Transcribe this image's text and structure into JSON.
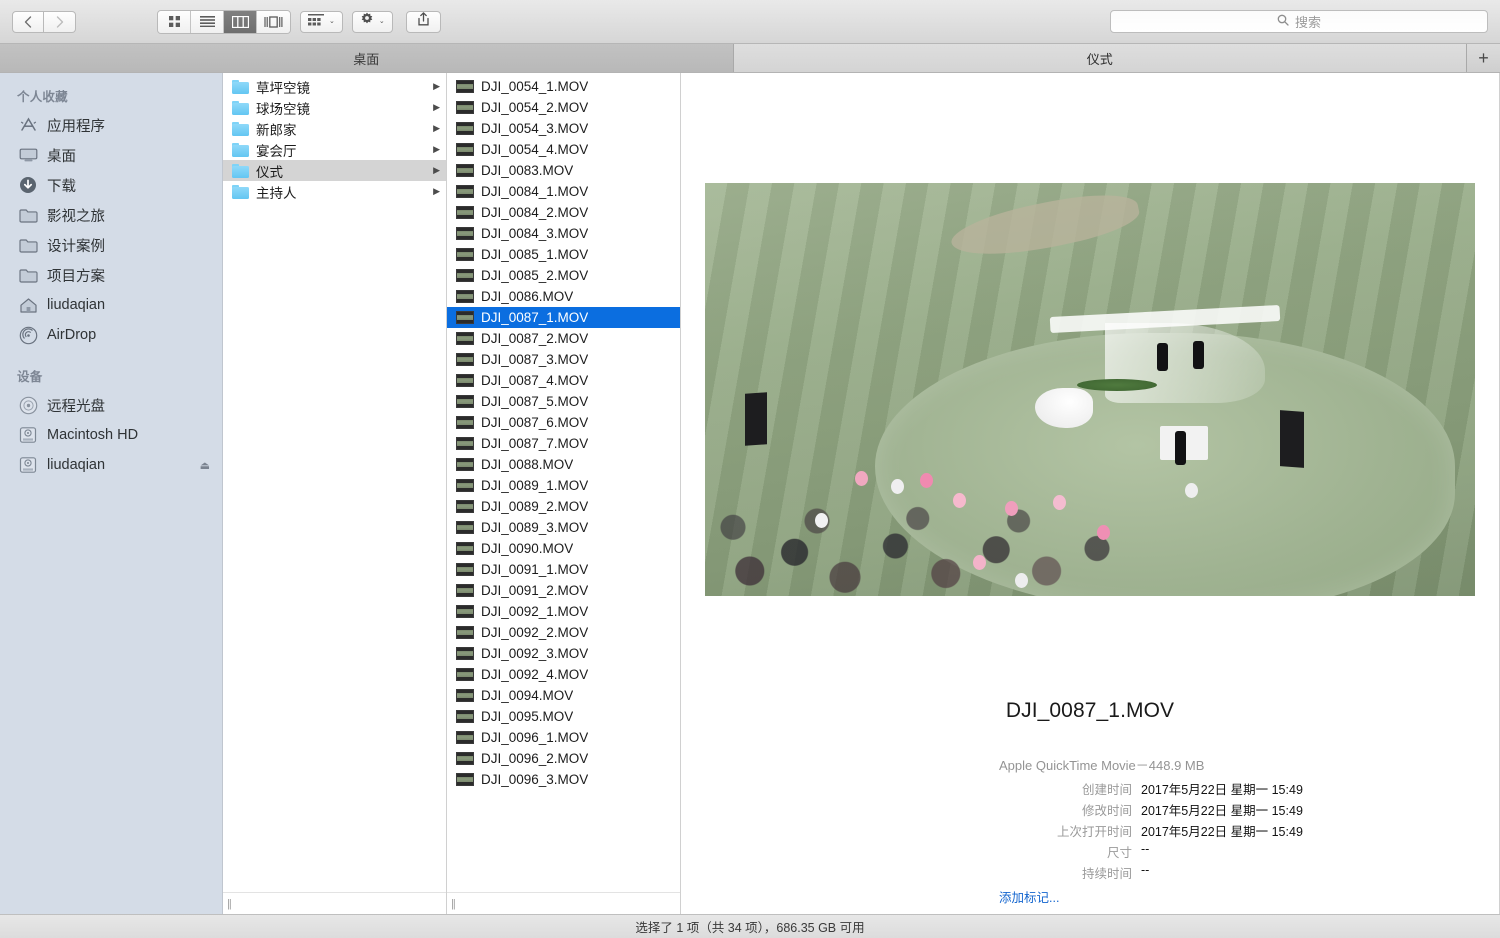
{
  "toolbar": {
    "back_label": "‹",
    "forward_label": "›",
    "view_icon_grid": "icon-view-icon",
    "view_list": "list-view-icon",
    "view_column": "column-view-icon",
    "view_gallery": "gallery-view-icon",
    "arrange_label": "arrange-icon",
    "action_label": "gear-icon",
    "share_label": "share-icon",
    "chevron": "⌄"
  },
  "search": {
    "placeholder": "搜索",
    "icon": "search-icon"
  },
  "tabs": [
    {
      "label": "桌面",
      "active": false
    },
    {
      "label": "仪式",
      "active": true
    }
  ],
  "tab_add_label": "+",
  "sidebar": {
    "sections": [
      {
        "header": "个人收藏",
        "items": [
          {
            "label": "应用程序",
            "icon": "applications-icon"
          },
          {
            "label": "桌面",
            "icon": "desktop-icon"
          },
          {
            "label": "下载",
            "icon": "downloads-icon"
          },
          {
            "label": "影视之旅",
            "icon": "folder-icon"
          },
          {
            "label": "设计案例",
            "icon": "folder-icon"
          },
          {
            "label": "项目方案",
            "icon": "folder-icon"
          },
          {
            "label": "liudaqian",
            "icon": "home-icon"
          },
          {
            "label": "AirDrop",
            "icon": "airdrop-icon"
          }
        ]
      },
      {
        "header": "设备",
        "items": [
          {
            "label": "远程光盘",
            "icon": "disc-icon"
          },
          {
            "label": "Macintosh HD",
            "icon": "harddisk-icon"
          },
          {
            "label": "liudaqian",
            "icon": "harddisk-icon",
            "eject": "⏏"
          }
        ]
      }
    ]
  },
  "columns": {
    "folders": [
      {
        "label": "草坪空镜",
        "selected": false
      },
      {
        "label": "球场空镜",
        "selected": false
      },
      {
        "label": "新郎家",
        "selected": false
      },
      {
        "label": "宴会厅",
        "selected": false
      },
      {
        "label": "仪式",
        "selected": true
      },
      {
        "label": "主持人",
        "selected": false
      }
    ],
    "files": [
      {
        "label": "DJI_0054_1.MOV",
        "selected": false
      },
      {
        "label": "DJI_0054_2.MOV",
        "selected": false
      },
      {
        "label": "DJI_0054_3.MOV",
        "selected": false
      },
      {
        "label": "DJI_0054_4.MOV",
        "selected": false
      },
      {
        "label": "DJI_0083.MOV",
        "selected": false
      },
      {
        "label": "DJI_0084_1.MOV",
        "selected": false
      },
      {
        "label": "DJI_0084_2.MOV",
        "selected": false
      },
      {
        "label": "DJI_0084_3.MOV",
        "selected": false
      },
      {
        "label": "DJI_0085_1.MOV",
        "selected": false
      },
      {
        "label": "DJI_0085_2.MOV",
        "selected": false
      },
      {
        "label": "DJI_0086.MOV",
        "selected": false
      },
      {
        "label": "DJI_0087_1.MOV",
        "selected": true
      },
      {
        "label": "DJI_0087_2.MOV",
        "selected": false
      },
      {
        "label": "DJI_0087_3.MOV",
        "selected": false
      },
      {
        "label": "DJI_0087_4.MOV",
        "selected": false
      },
      {
        "label": "DJI_0087_5.MOV",
        "selected": false
      },
      {
        "label": "DJI_0087_6.MOV",
        "selected": false
      },
      {
        "label": "DJI_0087_7.MOV",
        "selected": false
      },
      {
        "label": "DJI_0088.MOV",
        "selected": false
      },
      {
        "label": "DJI_0089_1.MOV",
        "selected": false
      },
      {
        "label": "DJI_0089_2.MOV",
        "selected": false
      },
      {
        "label": "DJI_0089_3.MOV",
        "selected": false
      },
      {
        "label": "DJI_0090.MOV",
        "selected": false
      },
      {
        "label": "DJI_0091_1.MOV",
        "selected": false
      },
      {
        "label": "DJI_0091_2.MOV",
        "selected": false
      },
      {
        "label": "DJI_0092_1.MOV",
        "selected": false
      },
      {
        "label": "DJI_0092_2.MOV",
        "selected": false
      },
      {
        "label": "DJI_0092_3.MOV",
        "selected": false
      },
      {
        "label": "DJI_0092_4.MOV",
        "selected": false
      },
      {
        "label": "DJI_0094.MOV",
        "selected": false
      },
      {
        "label": "DJI_0095.MOV",
        "selected": false
      },
      {
        "label": "DJI_0096_1.MOV",
        "selected": false
      },
      {
        "label": "DJI_0096_2.MOV",
        "selected": false
      },
      {
        "label": "DJI_0096_3.MOV",
        "selected": false
      }
    ]
  },
  "preview": {
    "image_alt": "aerial-wedding-ceremony-golf-course",
    "title": "DJI_0087_1.MOV",
    "subtitle": "Apple QuickTime Movie－448.9 MB",
    "fields": [
      {
        "label": "创建时间",
        "value": "2017年5月22日 星期一 15:49"
      },
      {
        "label": "修改时间",
        "value": "2017年5月22日 星期一 15:49"
      },
      {
        "label": "上次打开时间",
        "value": "2017年5月22日 星期一 15:49"
      },
      {
        "label": "尺寸",
        "value": "--"
      },
      {
        "label": "持续时间",
        "value": "--"
      }
    ],
    "add_tags_label": "添加标记..."
  },
  "statusbar": {
    "text": "选择了 1 项（共 34 项），686.35 GB 可用"
  },
  "resize_grip": "||",
  "colors": {
    "selection_blue": "#0b6ee0",
    "sidebar_bg": "#d4dce7",
    "folder_blue": "#63c6f2",
    "link_blue": "#1566cf"
  }
}
